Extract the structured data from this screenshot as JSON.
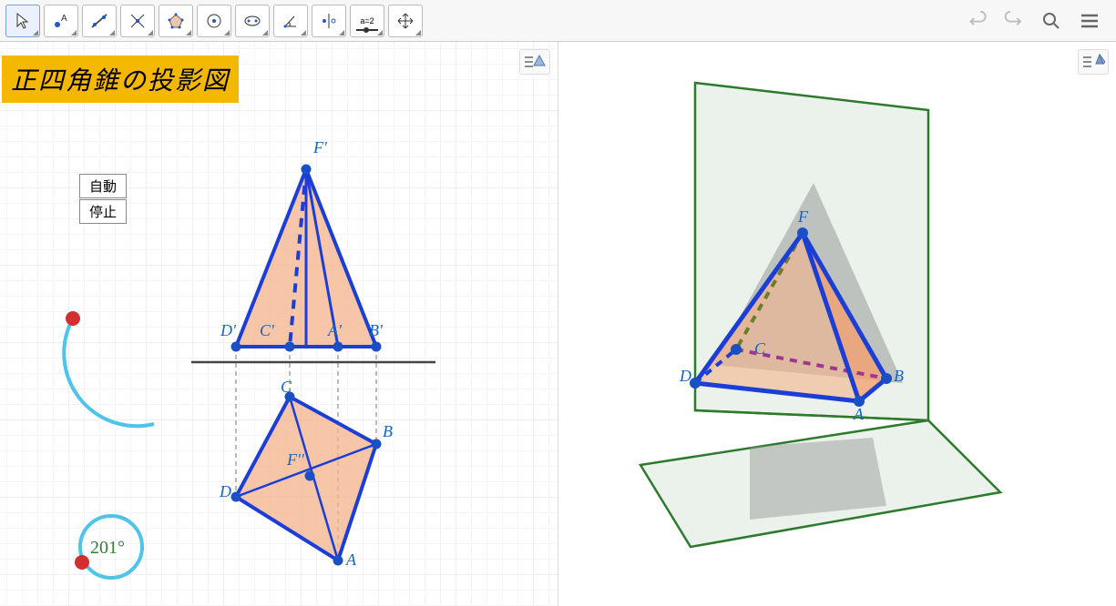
{
  "title": "正四角錐の投影図",
  "controls": {
    "auto": "自動",
    "stop": "停止"
  },
  "angle": "201°",
  "labels2d": {
    "Fprime": "F'",
    "Aprime": "A'",
    "Bprime": "B'",
    "Cprime": "C'",
    "Dprime": "D'",
    "A": "A",
    "B": "B",
    "C": "C",
    "D": "D",
    "Fdprime": "F''"
  },
  "labels3d": {
    "A": "A",
    "B": "B",
    "C": "C",
    "D": "D",
    "F": "F"
  },
  "toolbar": {
    "slider_text": "a=2"
  },
  "colors": {
    "line_blue": "#1b3fd6",
    "fill_orange": "#f4b28a",
    "point_blue": "#1950c5",
    "point_red": "#d32f2f",
    "arc_light": "#4fc3e8",
    "plane_green": "#2d7a2d",
    "plane_fill": "#e3ede3",
    "label_blue": "#1565c0",
    "angle_green": "#2e7d32"
  }
}
